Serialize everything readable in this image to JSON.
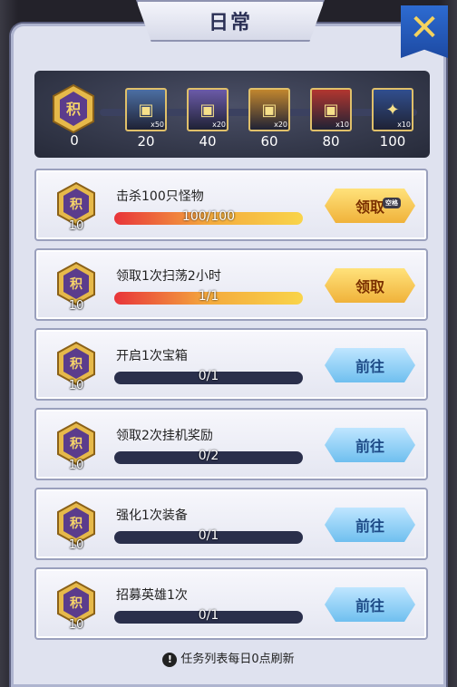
{
  "window": {
    "title": "日常",
    "close_icon": "close-x-icon"
  },
  "colors": {
    "accent_gold": "#f0b23a",
    "accent_blue": "#6fbfef",
    "panel": "#dfe2ef",
    "bar_fill": "#e8343a"
  },
  "points": {
    "icon": "积",
    "value": "0"
  },
  "chests": [
    {
      "name": "silver-chest",
      "mult": "x50",
      "threshold": "20",
      "color": "#4c6fa3"
    },
    {
      "name": "purple-chest",
      "mult": "x20",
      "threshold": "40",
      "color": "#6b5aa8"
    },
    {
      "name": "gold-chest",
      "mult": "x20",
      "threshold": "60",
      "color": "#c1862e"
    },
    {
      "name": "red-chest",
      "mult": "x10",
      "threshold": "80",
      "color": "#b2362f"
    },
    {
      "name": "star-card",
      "mult": "x10",
      "threshold": "100",
      "color": "#314f8e"
    }
  ],
  "tasks": [
    {
      "name": "击杀100只怪物",
      "points": "10",
      "progress": "100/100",
      "fill": 1,
      "button": "领取",
      "button_type": "claim",
      "tag": "空格"
    },
    {
      "name": "领取1次扫荡2小时",
      "points": "10",
      "progress": "1/1",
      "fill": 1,
      "button": "领取",
      "button_type": "claim",
      "tag": ""
    },
    {
      "name": "开启1次宝箱",
      "points": "10",
      "progress": "0/1",
      "fill": 0,
      "button": "前往",
      "button_type": "go",
      "tag": ""
    },
    {
      "name": "领取2次挂机奖励",
      "points": "10",
      "progress": "0/2",
      "fill": 0,
      "button": "前往",
      "button_type": "go",
      "tag": ""
    },
    {
      "name": "强化1次装备",
      "points": "10",
      "progress": "0/1",
      "fill": 0,
      "button": "前往",
      "button_type": "go",
      "tag": ""
    },
    {
      "name": "招募英雄1次",
      "points": "10",
      "progress": "0/1",
      "fill": 0,
      "button": "前往",
      "button_type": "go",
      "tag": ""
    }
  ],
  "footer": {
    "warning_icon": "!",
    "text": "任务列表每日0点刷新"
  }
}
